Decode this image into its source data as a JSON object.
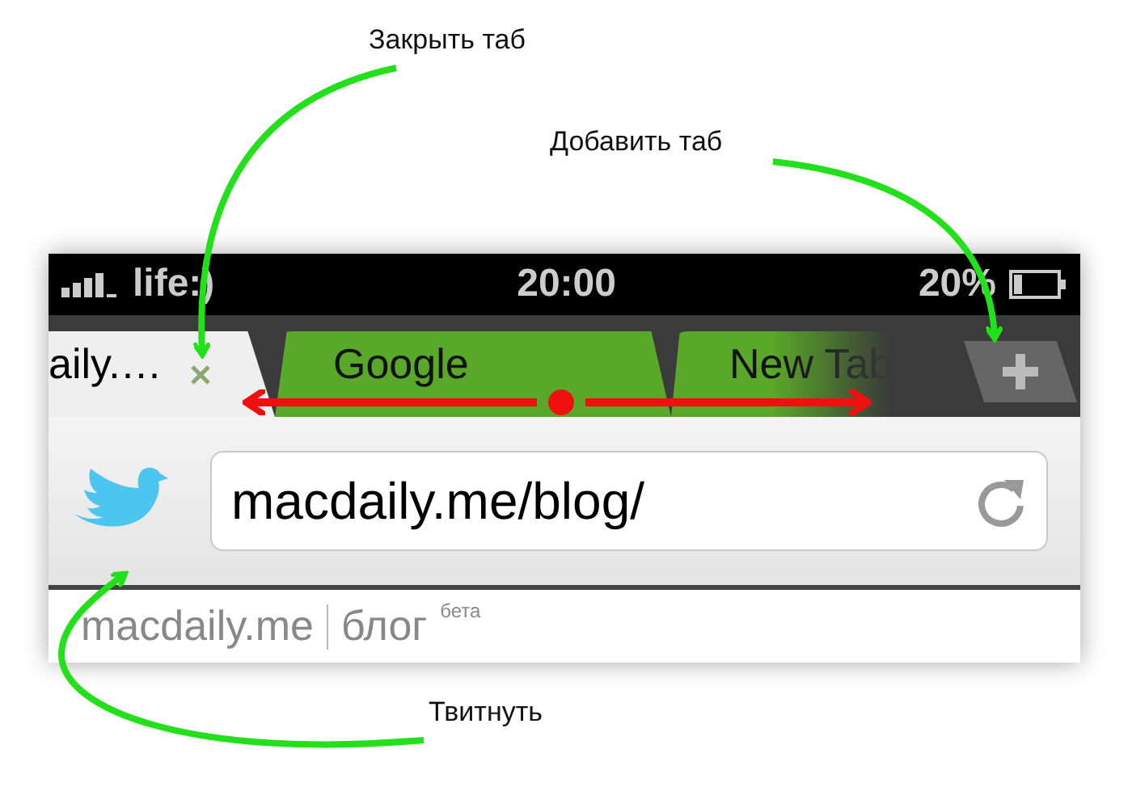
{
  "annotations": [
    {
      "kind": "close",
      "text": "Закрыть таб"
    },
    {
      "kind": "add",
      "text": "Добавить таб"
    },
    {
      "kind": "tweet",
      "text": "Твитнуть"
    }
  ],
  "status_bar": {
    "carrier": "life:)",
    "time": "20:00",
    "battery": "20%"
  },
  "tabs": [
    {
      "title": "aily.…",
      "selected": true
    },
    {
      "title": "Google",
      "selected": false
    },
    {
      "title": "New Tab",
      "selected": false
    }
  ],
  "address_bar": {
    "url": "macdaily.me/blog/"
  },
  "page": {
    "logo": "macdaily.me",
    "section": "блог",
    "badge": "бета"
  }
}
